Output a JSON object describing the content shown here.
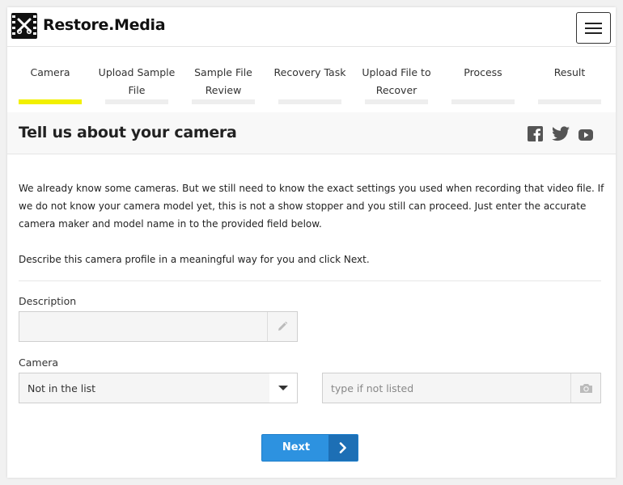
{
  "header": {
    "brand": "Restore.Media"
  },
  "steps": [
    {
      "label": "Camera",
      "active": true
    },
    {
      "label": "Upload Sample File",
      "active": false
    },
    {
      "label": "Sample File Review",
      "active": false
    },
    {
      "label": "Recovery Task",
      "active": false
    },
    {
      "label": "Upload File to Recover",
      "active": false
    },
    {
      "label": "Process",
      "active": false
    },
    {
      "label": "Result",
      "active": false
    }
  ],
  "section": {
    "title": "Tell us about your camera",
    "social_icons": [
      "facebook-icon",
      "twitter-icon",
      "youtube-icon"
    ]
  },
  "content": {
    "intro": "We already know some cameras. But we still need to know the exact settings you used when recording that video file. If we do not know your camera model yet, this is not a show stopper and you still can proceed. Just enter the accurate camera maker and model name in to the provided field below.",
    "instruction": "Describe this camera profile in a meaningful way for you and click Next."
  },
  "form": {
    "description_label": "Description",
    "description_value": "",
    "description_icon": "pencil-icon",
    "camera_label": "Camera",
    "camera_selected": "Not in the list",
    "camera_custom_placeholder": "type if not listed",
    "camera_custom_icon": "camera-icon"
  },
  "actions": {
    "next_label": "Next"
  },
  "colors": {
    "accent": "#2d92e0",
    "accent_dark": "#1d6fb5",
    "active_step": "#f2f000"
  }
}
